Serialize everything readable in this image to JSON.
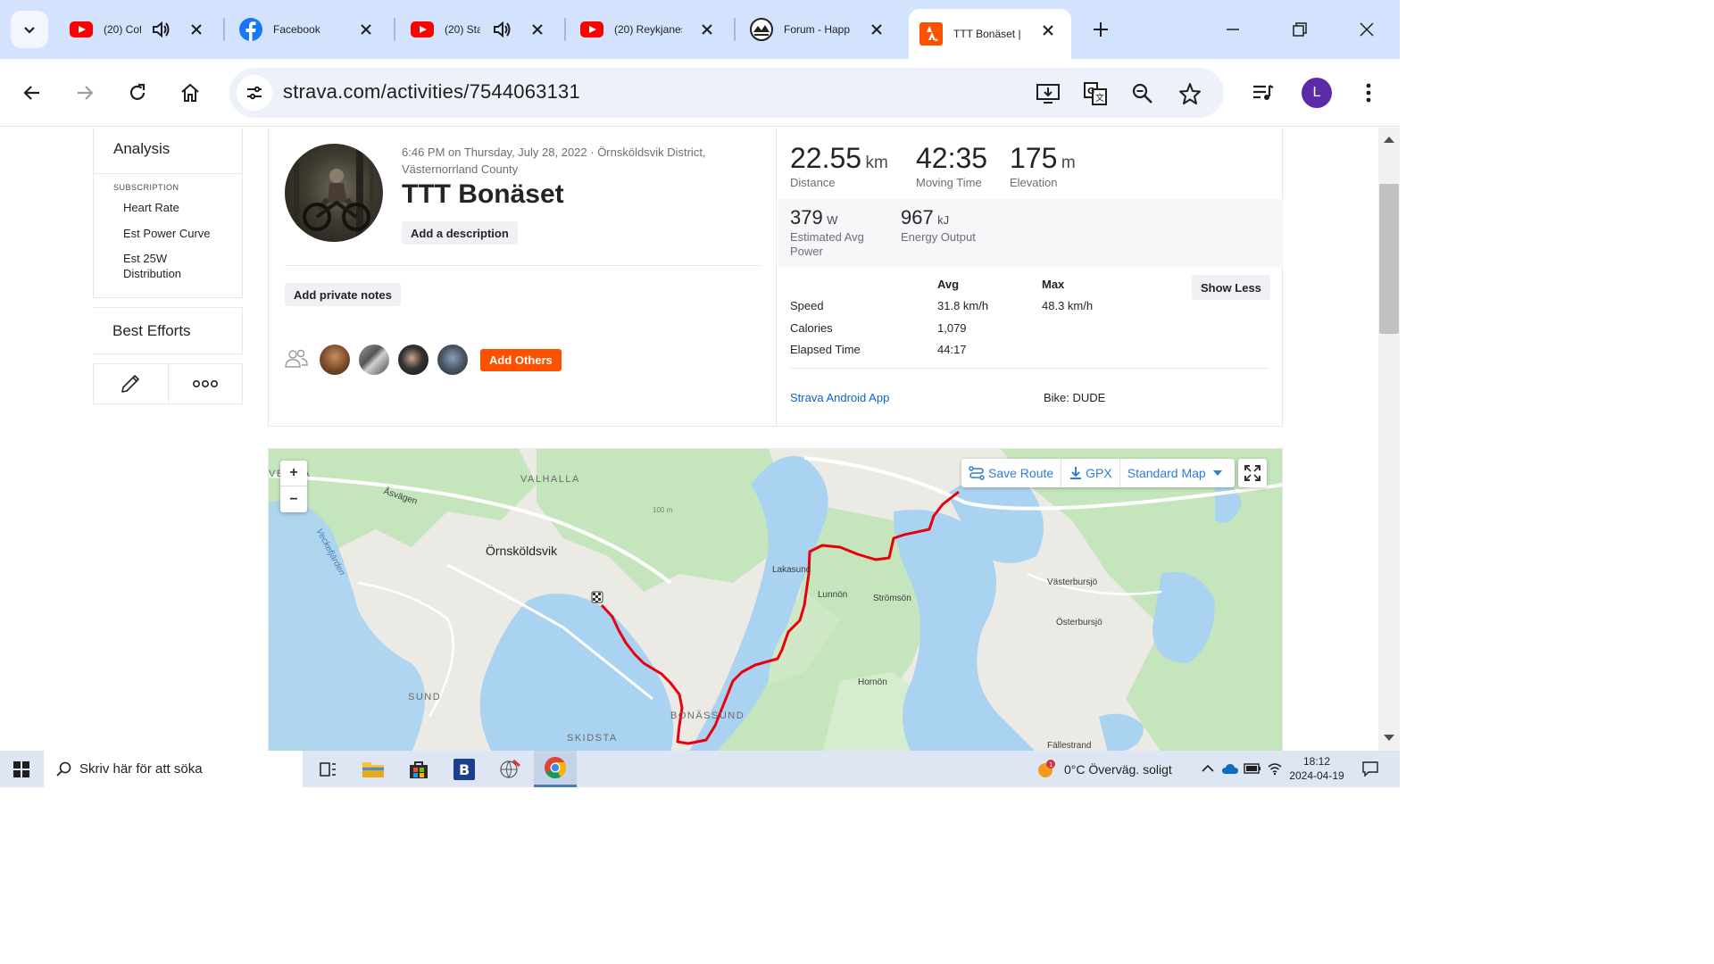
{
  "browser": {
    "tabs": [
      {
        "title": "(20) Cof",
        "icon": "youtube-icon",
        "audio": true
      },
      {
        "title": "Facebook",
        "icon": "facebook-icon",
        "audio": false
      },
      {
        "title": "(20) Sta",
        "icon": "youtube-icon",
        "audio": true
      },
      {
        "title": "(20) Reykjanes",
        "icon": "youtube-icon",
        "audio": false
      },
      {
        "title": "Forum - Happ",
        "icon": "forum-icon",
        "audio": false
      },
      {
        "title": "TTT Bonäset |",
        "icon": "strava-icon",
        "audio": false,
        "active": true
      }
    ],
    "url": "strava.com/activities/7544063131",
    "profile_initial": "L"
  },
  "sidenav": {
    "analysis": "Analysis",
    "subscription": "SUBSCRIPTION",
    "items": [
      "Heart Rate",
      "Est Power Curve",
      "Est 25W Distribution"
    ],
    "best_efforts": "Best Efforts"
  },
  "activity": {
    "meta": "6:46 PM on Thursday, July 28, 2022 · Örnsköldsvik District, Västernorrland County",
    "title": "TTT Bonäset",
    "add_description": "Add a description",
    "add_private_notes": "Add private notes",
    "add_others": "Add Others"
  },
  "stats": {
    "distance": {
      "value": "22.55",
      "unit": "km",
      "label": "Distance"
    },
    "moving_time": {
      "value": "42:35",
      "label": "Moving Time"
    },
    "elevation": {
      "value": "175",
      "unit": "m",
      "label": "Elevation"
    },
    "power": {
      "value": "379",
      "unit": "W",
      "label": "Estimated Avg Power"
    },
    "energy": {
      "value": "967",
      "unit": "kJ",
      "label": "Energy Output"
    }
  },
  "detail_table": {
    "headers": {
      "avg": "Avg",
      "max": "Max"
    },
    "rows": [
      {
        "label": "Speed",
        "avg": "31.8 km/h",
        "max": "48.3 km/h"
      },
      {
        "label": "Calories",
        "avg": "1,079",
        "max": ""
      },
      {
        "label": "Elapsed Time",
        "avg": "44:17",
        "max": ""
      }
    ],
    "show_less": "Show Less",
    "device": "Strava Android App",
    "bike": "Bike: DUDE"
  },
  "map": {
    "save_route": "Save Route",
    "gpx": "GPX",
    "map_type": "Standard Map",
    "zoom_in": "+",
    "zoom_out": "−",
    "labels": {
      "valhalla": "VALHALLA",
      "vesala": "VE   ALA",
      "asvagen": "Åsvägen",
      "ornskoldsvik": "Örnsköldsvik",
      "veckefjarden": "Veckefjärden",
      "elev": "100 m",
      "lakasund": "Lakasund",
      "lunnon": "Lunnön",
      "stromson": "Strömsön",
      "vasterbursjo": "Västerbursjö",
      "osterbursjo": "Österbursjö",
      "hornon": "Hornön",
      "sund": "SUND",
      "bonassund": "BONÄSSUND",
      "skidsta": "SKIDSTA",
      "fallestrand": "Fällestrand"
    },
    "route_color": "#e8000b"
  },
  "taskbar": {
    "search_placeholder": "Skriv här för att söka",
    "weather": "0°C  Överväg. soligt",
    "time": "18:12",
    "date": "2024-04-19"
  },
  "colors": {
    "strava_orange": "#fc5200",
    "link_blue": "#0a66c2",
    "map_water": "#aad3f1",
    "map_forest": "#c5e5bd"
  }
}
